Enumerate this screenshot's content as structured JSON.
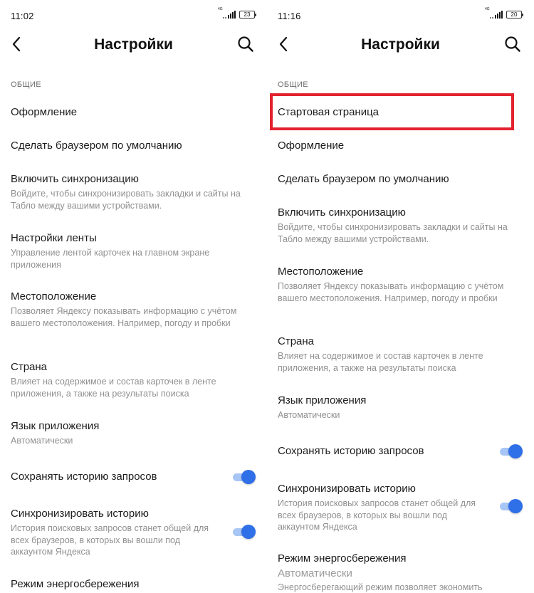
{
  "colors": {
    "accent": "#2f6fe8",
    "toggle_track": "#a7c6f6",
    "highlight_border": "#e2222e",
    "secondary_text": "#909090",
    "section_header": "#6e6e6e"
  },
  "icons": {
    "back": "chevron-left-icon",
    "search": "search-icon",
    "signal": "signal-bars-icon",
    "battery": "battery-icon"
  },
  "left": {
    "status": {
      "time": "11:02",
      "network": "4G",
      "battery": "23"
    },
    "header": {
      "title": "Настройки"
    },
    "section": "ОБЩИЕ",
    "items": [
      {
        "title": "Оформление"
      },
      {
        "title": "Сделать браузером по умолчанию"
      },
      {
        "title": "Включить синхронизацию",
        "desc": "Войдите, чтобы синхронизировать закладки и сайты на Табло между вашими устройствами."
      },
      {
        "title": "Настройки ленты",
        "desc": "Управление лентой карточек на главном экране приложения"
      },
      {
        "title": "Местоположение",
        "desc": "Позволяет Яндексу показывать информацию с учётом вашего местоположения. Например, погоду и пробки"
      },
      {
        "title": "Страна",
        "desc": "Влияет на содержимое и состав карточек в ленте приложения, а также на результаты поиска"
      },
      {
        "title": "Язык приложения",
        "desc": "Автоматически"
      },
      {
        "title": "Сохранять историю запросов",
        "toggle": true
      },
      {
        "title": "Синхронизировать историю",
        "desc": "История поисковых запросов станет общей для всех браузеров, в которых вы вошли под аккаунтом Яндекса",
        "toggle": true
      },
      {
        "title": "Режим энергосбережения"
      }
    ]
  },
  "right": {
    "status": {
      "time": "11:16",
      "network": "4G",
      "battery": "20"
    },
    "header": {
      "title": "Настройки"
    },
    "section": "ОБЩИЕ",
    "items": [
      {
        "title": "Стартовая страница",
        "highlighted": true
      },
      {
        "title": "Оформление"
      },
      {
        "title": "Сделать браузером по умолчанию"
      },
      {
        "title": "Включить синхронизацию",
        "desc": "Войдите, чтобы синхронизировать закладки и сайты на Табло между вашими устройствами."
      },
      {
        "title": "Местоположение",
        "desc": "Позволяет Яндексу показывать информацию с учётом вашего местоположения. Например, погоду и пробки"
      },
      {
        "title": "Страна",
        "desc": "Влияет на содержимое и состав карточек в ленте приложения, а также на результаты поиска"
      },
      {
        "title": "Язык приложения",
        "desc": "Автоматически"
      },
      {
        "title": "Сохранять историю запросов",
        "toggle": true
      },
      {
        "title": "Синхронизировать историю",
        "desc": "История поисковых запросов станет общей для всех браузеров, в которых вы вошли под аккаунтом Яндекса",
        "toggle": true
      },
      {
        "title": "Режим энергосбережения",
        "desc": "Автоматически",
        "desc2": "Энергосберегающий режим позволяет экономить"
      }
    ]
  }
}
